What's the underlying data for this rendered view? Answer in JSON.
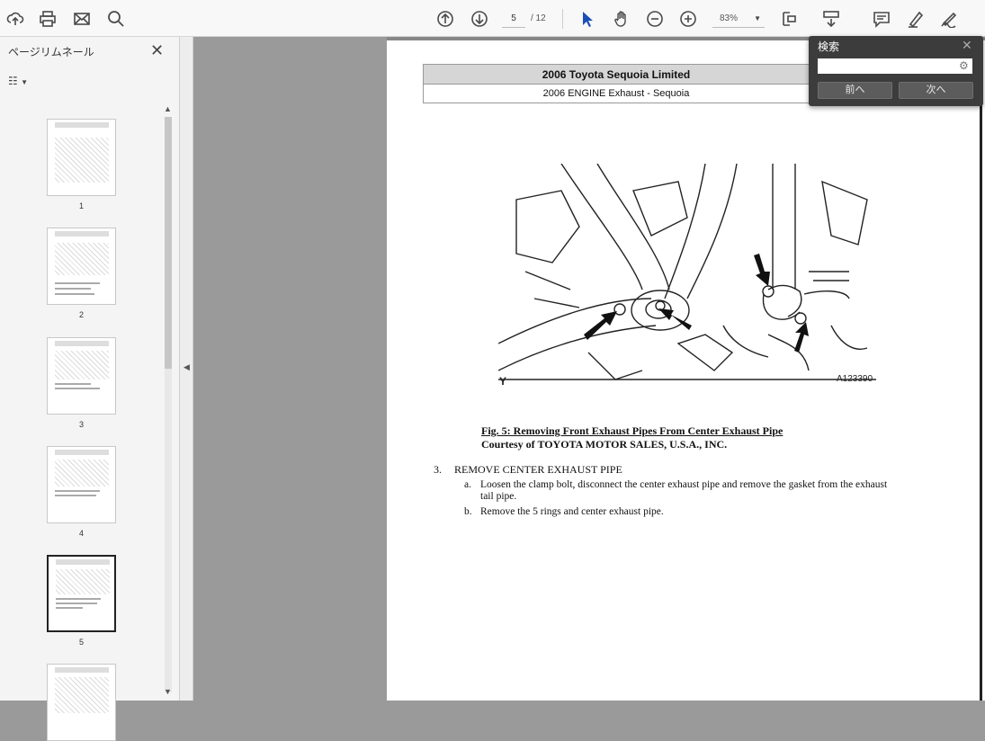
{
  "toolbar": {
    "current_page": "5",
    "total_pages": "/ 12",
    "zoom": "83%",
    "icons": [
      "cloud-upload-icon",
      "print-icon",
      "mail-icon",
      "search-icon",
      "prev-page-icon",
      "next-page-icon",
      "select-cursor-icon",
      "hand-tool-icon",
      "zoom-out-icon",
      "zoom-in-icon",
      "fit-page-icon",
      "scroll-mode-icon",
      "comment-icon",
      "highlight-icon",
      "sign-icon"
    ]
  },
  "left_panel": {
    "title": "ページリムネール",
    "thumbnails": [
      {
        "label": "1"
      },
      {
        "label": "2"
      },
      {
        "label": "3"
      },
      {
        "label": "4"
      },
      {
        "label": "5"
      }
    ]
  },
  "document": {
    "header_title": "2006 Toyota Sequoia Limited",
    "header_subtitle": "2006 ENGINE Exhaust - Sequoia",
    "figure_letter": "Y",
    "figure_id": "A123390",
    "caption_title": "Fig. 5: Removing Front Exhaust Pipes From Center Exhaust Pipe",
    "caption_courtesy": "Courtesy of TOYOTA MOTOR SALES, U.S.A., INC.",
    "step_number": "3.",
    "step_title": "REMOVE CENTER EXHAUST PIPE",
    "substeps": [
      {
        "letter": "a.",
        "text_line1": "Loosen the clamp bolt, disconnect the center exhaust pipe and remove the gasket from the exhaust",
        "text_line2": "tail pipe."
      },
      {
        "letter": "b.",
        "text_line1": "Remove the 5 rings and center exhaust pipe.",
        "text_line2": ""
      }
    ]
  },
  "search": {
    "title": "検索",
    "placeholder": "",
    "prev_label": "前へ",
    "next_label": "次へ"
  }
}
